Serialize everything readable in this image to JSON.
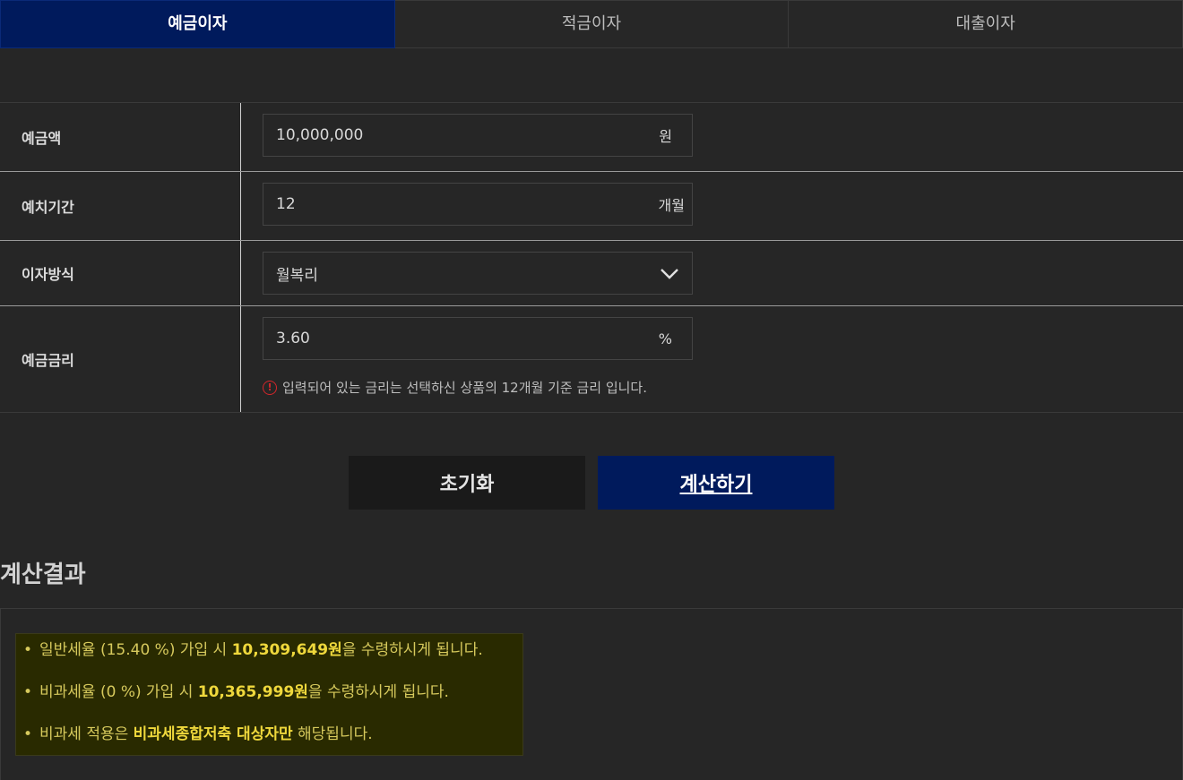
{
  "tabs": [
    {
      "label": "예금이자",
      "active": true
    },
    {
      "label": "적금이자",
      "active": false
    },
    {
      "label": "대출이자",
      "active": false
    }
  ],
  "form": {
    "amount": {
      "label": "예금액",
      "value": "10,000,000",
      "unit": "원"
    },
    "period": {
      "label": "예치기간",
      "value": "12",
      "unit": "개월"
    },
    "method": {
      "label": "이자방식",
      "value": "월복리"
    },
    "rate": {
      "label": "예금금리",
      "value": "3.60",
      "unit": "%",
      "note": "입력되어 있는 금리는 선택하신 상품의 12개월 기준 금리 입니다."
    }
  },
  "buttons": {
    "reset": "초기화",
    "calculate": "계산하기"
  },
  "result": {
    "title": "계산결과",
    "lines": [
      {
        "pre": "일반세율 (15.40 %) 가입 시 ",
        "bold": "10,309,649원",
        "post": "을 수령하시게 됩니다."
      },
      {
        "pre": "비과세율 (0 %) 가입 시 ",
        "bold": "10,365,999원",
        "post": "을 수령하시게 됩니다."
      },
      {
        "pre": "비과세 적용은 ",
        "bold": "비과세종합저축 대상자만",
        "post": " 해당됩니다."
      }
    ]
  },
  "colors": {
    "accent": "#001a5c",
    "highlight": "#efd83c",
    "warning": "#d4262b"
  }
}
